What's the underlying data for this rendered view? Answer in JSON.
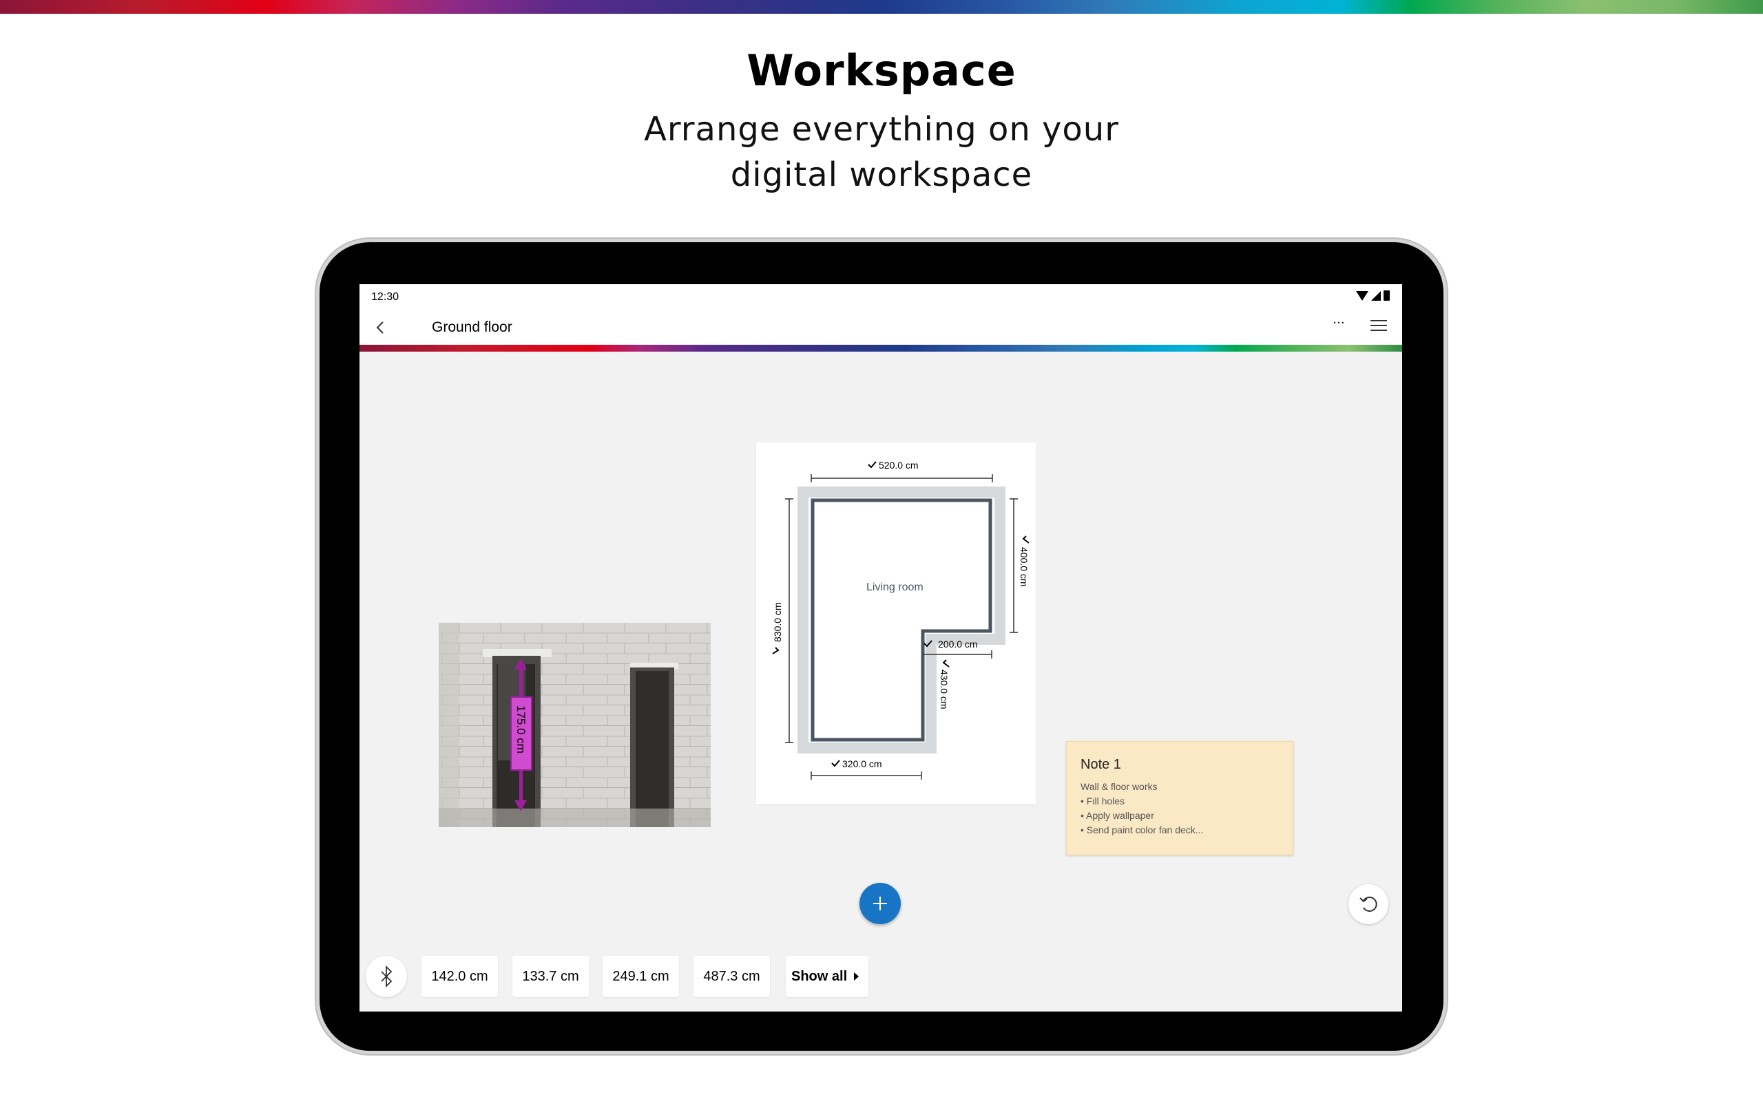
{
  "hero": {
    "title": "Workspace",
    "subtitle_line1": "Arrange everything on your",
    "subtitle_line2": "digital workspace"
  },
  "status_bar": {
    "time": "12:30"
  },
  "app_bar": {
    "title": "Ground floor",
    "more_label": "···"
  },
  "photo": {
    "measurement": "175.0 cm"
  },
  "floor_plan": {
    "room_name": "Living room",
    "dim_top": "520.0 cm",
    "dim_left": "830.0 cm",
    "dim_right": "400.0 cm",
    "dim_step_horizontal": "200.0 cm",
    "dim_step_vertical": "430.0 cm",
    "dim_bottom": "320.0 cm"
  },
  "note": {
    "title": "Note 1",
    "lines": [
      "Wall & floor works",
      "• Fill holes",
      "• Apply wallpaper",
      "• Send paint color fan deck..."
    ]
  },
  "measurements": {
    "chips": [
      "142.0 cm",
      "133.7 cm",
      "249.1 cm",
      "487.3 cm"
    ],
    "show_all_label": "Show all"
  },
  "colors": {
    "accent_blue": "#1874c4",
    "measure_magenta": "#c03cc0",
    "note_background": "#fbe8c4",
    "wall_color": "#4a5560"
  }
}
